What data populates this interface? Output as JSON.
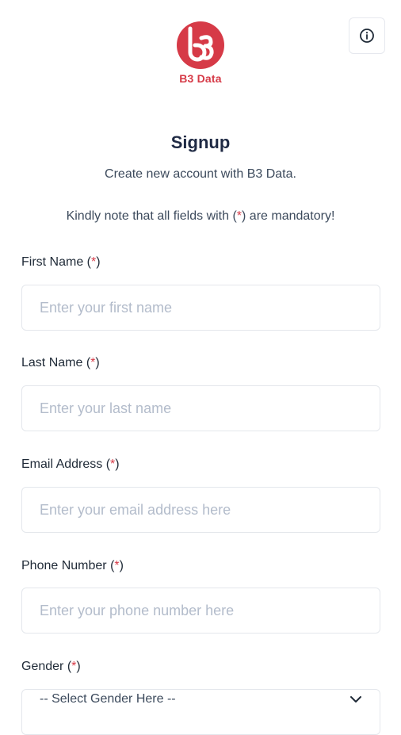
{
  "brand": {
    "name": "B3 Data",
    "accent_color": "#d63a47",
    "logo_icon": "b3-logo-icon"
  },
  "header": {
    "info_icon": "info-icon"
  },
  "page": {
    "title": "Signup",
    "subtitle": "Create new account with B3 Data.",
    "note_prefix": "Kindly note that all fields with (",
    "note_star": "*",
    "note_suffix": ") are mandatory!"
  },
  "form": {
    "required_mark": "*",
    "first_name": {
      "label": "First Name",
      "placeholder": "Enter your first name",
      "value": ""
    },
    "last_name": {
      "label": "Last Name",
      "placeholder": "Enter your last name",
      "value": ""
    },
    "email": {
      "label": "Email Address",
      "placeholder": "Enter your email address here",
      "value": ""
    },
    "phone": {
      "label": "Phone Number",
      "placeholder": "Enter your phone number here",
      "value": ""
    },
    "gender": {
      "label": "Gender",
      "selected": "-- Select Gender Here --",
      "chevron_icon": "chevron-down-icon"
    }
  }
}
